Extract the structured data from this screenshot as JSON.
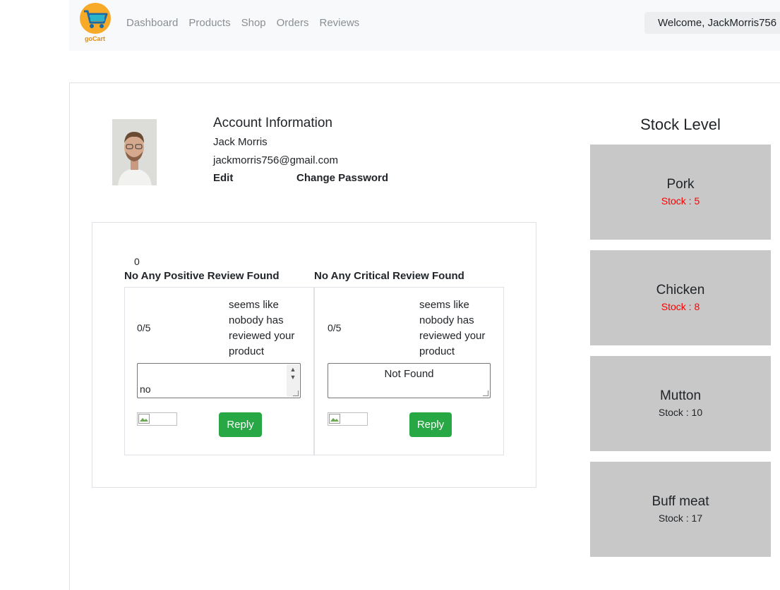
{
  "brand": {
    "name": "goCart"
  },
  "nav": {
    "links": [
      "Dashboard",
      "Products",
      "Shop",
      "Orders",
      "Reviews"
    ],
    "welcome": "Welcome, JackMorris756"
  },
  "account": {
    "title": "Account Information",
    "name": "Jack Morris",
    "email": "jackmorris756@gmail.com",
    "edit_label": "Edit",
    "change_password_label": "Change Password"
  },
  "reviews": {
    "count": "0",
    "positive": {
      "title": "No Any Positive Review Found",
      "rating": "0/5",
      "message": "seems like nobody has reviewed your product",
      "reply_text": "no",
      "reply_label": "Reply"
    },
    "critical": {
      "title": "No Any Critical Review Found",
      "rating": "0/5",
      "message": "seems like nobody has reviewed your product",
      "reply_text": "Not Found",
      "reply_label": "Reply"
    }
  },
  "stock": {
    "title": "Stock Level",
    "items": [
      {
        "name": "Pork",
        "stock": "Stock : 5",
        "color": "#ff0000"
      },
      {
        "name": "Chicken",
        "stock": "Stock : 8",
        "color": "#ff0000"
      },
      {
        "name": "Mutton",
        "stock": "Stock : 10",
        "color": "#212529"
      },
      {
        "name": "Buff meat",
        "stock": "Stock : 17",
        "color": "#212529"
      }
    ]
  }
}
